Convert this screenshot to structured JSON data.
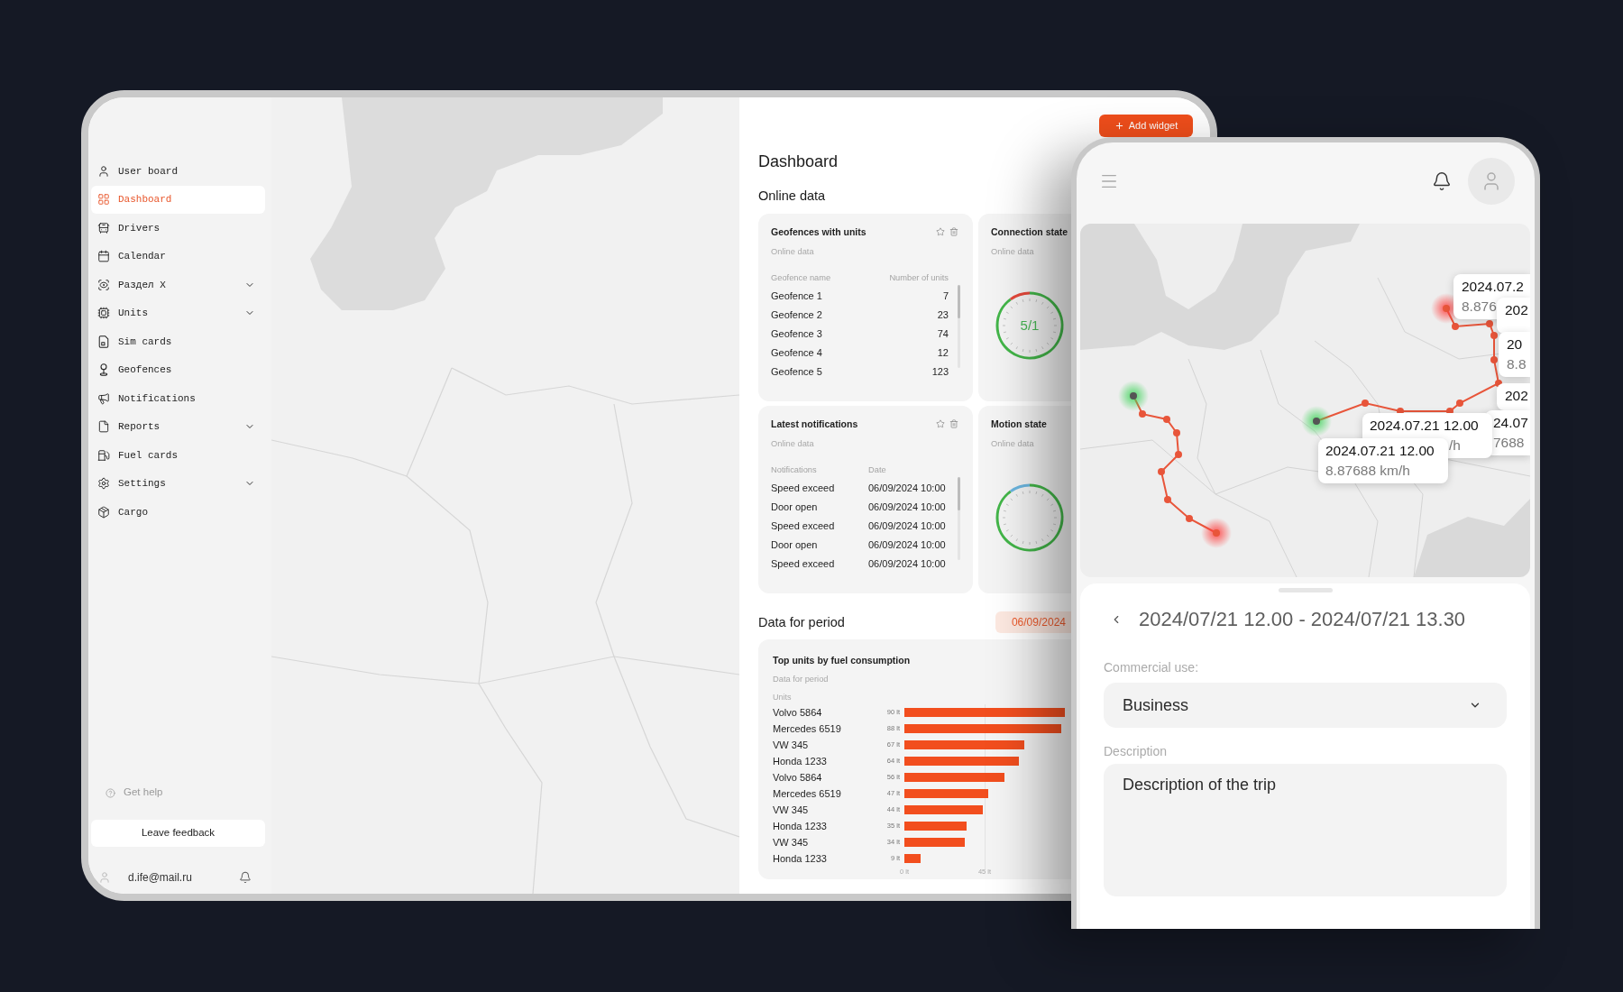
{
  "sidebar": {
    "items": [
      {
        "label": "User board",
        "selected": false,
        "expandable": false
      },
      {
        "label": "Dashboard",
        "selected": true,
        "expandable": false
      },
      {
        "label": "Drivers",
        "selected": false,
        "expandable": false
      },
      {
        "label": "Calendar",
        "selected": false,
        "expandable": false
      },
      {
        "label": "Раздел X",
        "selected": false,
        "expandable": true
      },
      {
        "label": "Units",
        "selected": false,
        "expandable": true
      },
      {
        "label": "Sim cards",
        "selected": false,
        "expandable": false
      },
      {
        "label": "Geofences",
        "selected": false,
        "expandable": false
      },
      {
        "label": "Notifications",
        "selected": false,
        "expandable": false
      },
      {
        "label": "Reports",
        "selected": false,
        "expandable": true
      },
      {
        "label": "Fuel cards",
        "selected": false,
        "expandable": false
      },
      {
        "label": "Settings",
        "selected": false,
        "expandable": true
      },
      {
        "label": "Cargo",
        "selected": false,
        "expandable": false
      }
    ],
    "help": "Get help",
    "feedback_button": "Leave feedback",
    "user_email": "d.ife@mail.ru"
  },
  "dashboard": {
    "title": "Dashboard",
    "add_button": "Add widget",
    "online": {
      "title": "Online data",
      "widgets": [
        {
          "kind": "tally",
          "title": "Geofences with units",
          "subtitle": "Online data",
          "columns": [
            "Geofence name",
            "Number of units"
          ],
          "rows": [
            [
              "Geofence 1",
              "7"
            ],
            [
              "Geofence 2",
              "23"
            ],
            [
              "Geofence 3",
              "74"
            ],
            [
              "Geofence 4",
              "12"
            ],
            [
              "Geofence 5",
              "123"
            ]
          ]
        },
        {
          "kind": "gauge",
          "title": "Connection state",
          "subtitle": "Online data",
          "reading": "5/1",
          "level": 0.9,
          "color": "#e5483b"
        },
        {
          "kind": "log",
          "title": "Latest notifications",
          "subtitle": "Online data",
          "columns": [
            "Notifications",
            "Date"
          ],
          "rows": [
            [
              "Speed exceed",
              "06/09/2024 10:00"
            ],
            [
              "Door open",
              "06/09/2024 10:00"
            ],
            [
              "Speed exceed",
              "06/09/2024 10:00"
            ],
            [
              "Door open",
              "06/09/2024 10:00"
            ],
            [
              "Speed exceed",
              "06/09/2024 10:00"
            ]
          ]
        },
        {
          "kind": "gauge",
          "title": "Motion state",
          "subtitle": "Online data",
          "level": 0.9,
          "color": "#6cb6e0"
        }
      ]
    },
    "period": {
      "title": "Data for period",
      "date": "06/09/2024",
      "widgets": [
        {
          "kind": "chart",
          "subtitle": "Data for period",
          "chart_data": {
            "type": "bar",
            "orientation": "horizontal",
            "title": "Top units by fuel consumption",
            "ylabel": "Units",
            "categories": [
              "Volvo 5864",
              "Mercedes 6519",
              "VW 345",
              "Honda 1233",
              "Volvo 5864",
              "Mercedes 6519",
              "VW 345",
              "Honda 1233",
              "VW 345",
              "Honda 1233"
            ],
            "values": [
              90,
              88,
              67,
              64,
              56,
              47,
              44,
              35,
              34,
              9
            ],
            "value_labels": [
              "90 lt",
              "88 lt",
              "67 lt",
              "64 lt",
              "56 lt",
              "47 lt",
              "44 lt",
              "35 lt",
              "34 lt",
              "9 lt"
            ],
            "xlim": [
              0,
              90
            ],
            "xticks": [
              {
                "value": 0,
                "label": "0 lt"
              },
              {
                "value": 45,
                "label": "45 lt"
              }
            ],
            "ref_lines": [
              {
                "axis": "x",
                "value": 45
              }
            ]
          }
        }
      ]
    }
  },
  "phone": {
    "map_popups": [
      {
        "time": "2024.07.2",
        "speed": "8.876"
      },
      {
        "time": "202"
      },
      {
        "time": "20",
        "speed": "8.8"
      },
      {
        "time": "202"
      },
      {
        "time": "24.07",
        "speed": "7688"
      },
      {
        "time": "2024.07.21 12.00",
        "speed": "/h"
      },
      {
        "time": "2024.07.21 12.00",
        "speed": "8.87688 km/h"
      }
    ],
    "sheet": {
      "title": "2024/07/21 12.00 - 2024/07/21 13.30",
      "fields": [
        {
          "kind": "select",
          "label": "Commercial use:",
          "value": "Business"
        },
        {
          "kind": "textarea",
          "label": "Description",
          "value": "Description of the trip"
        }
      ]
    }
  }
}
